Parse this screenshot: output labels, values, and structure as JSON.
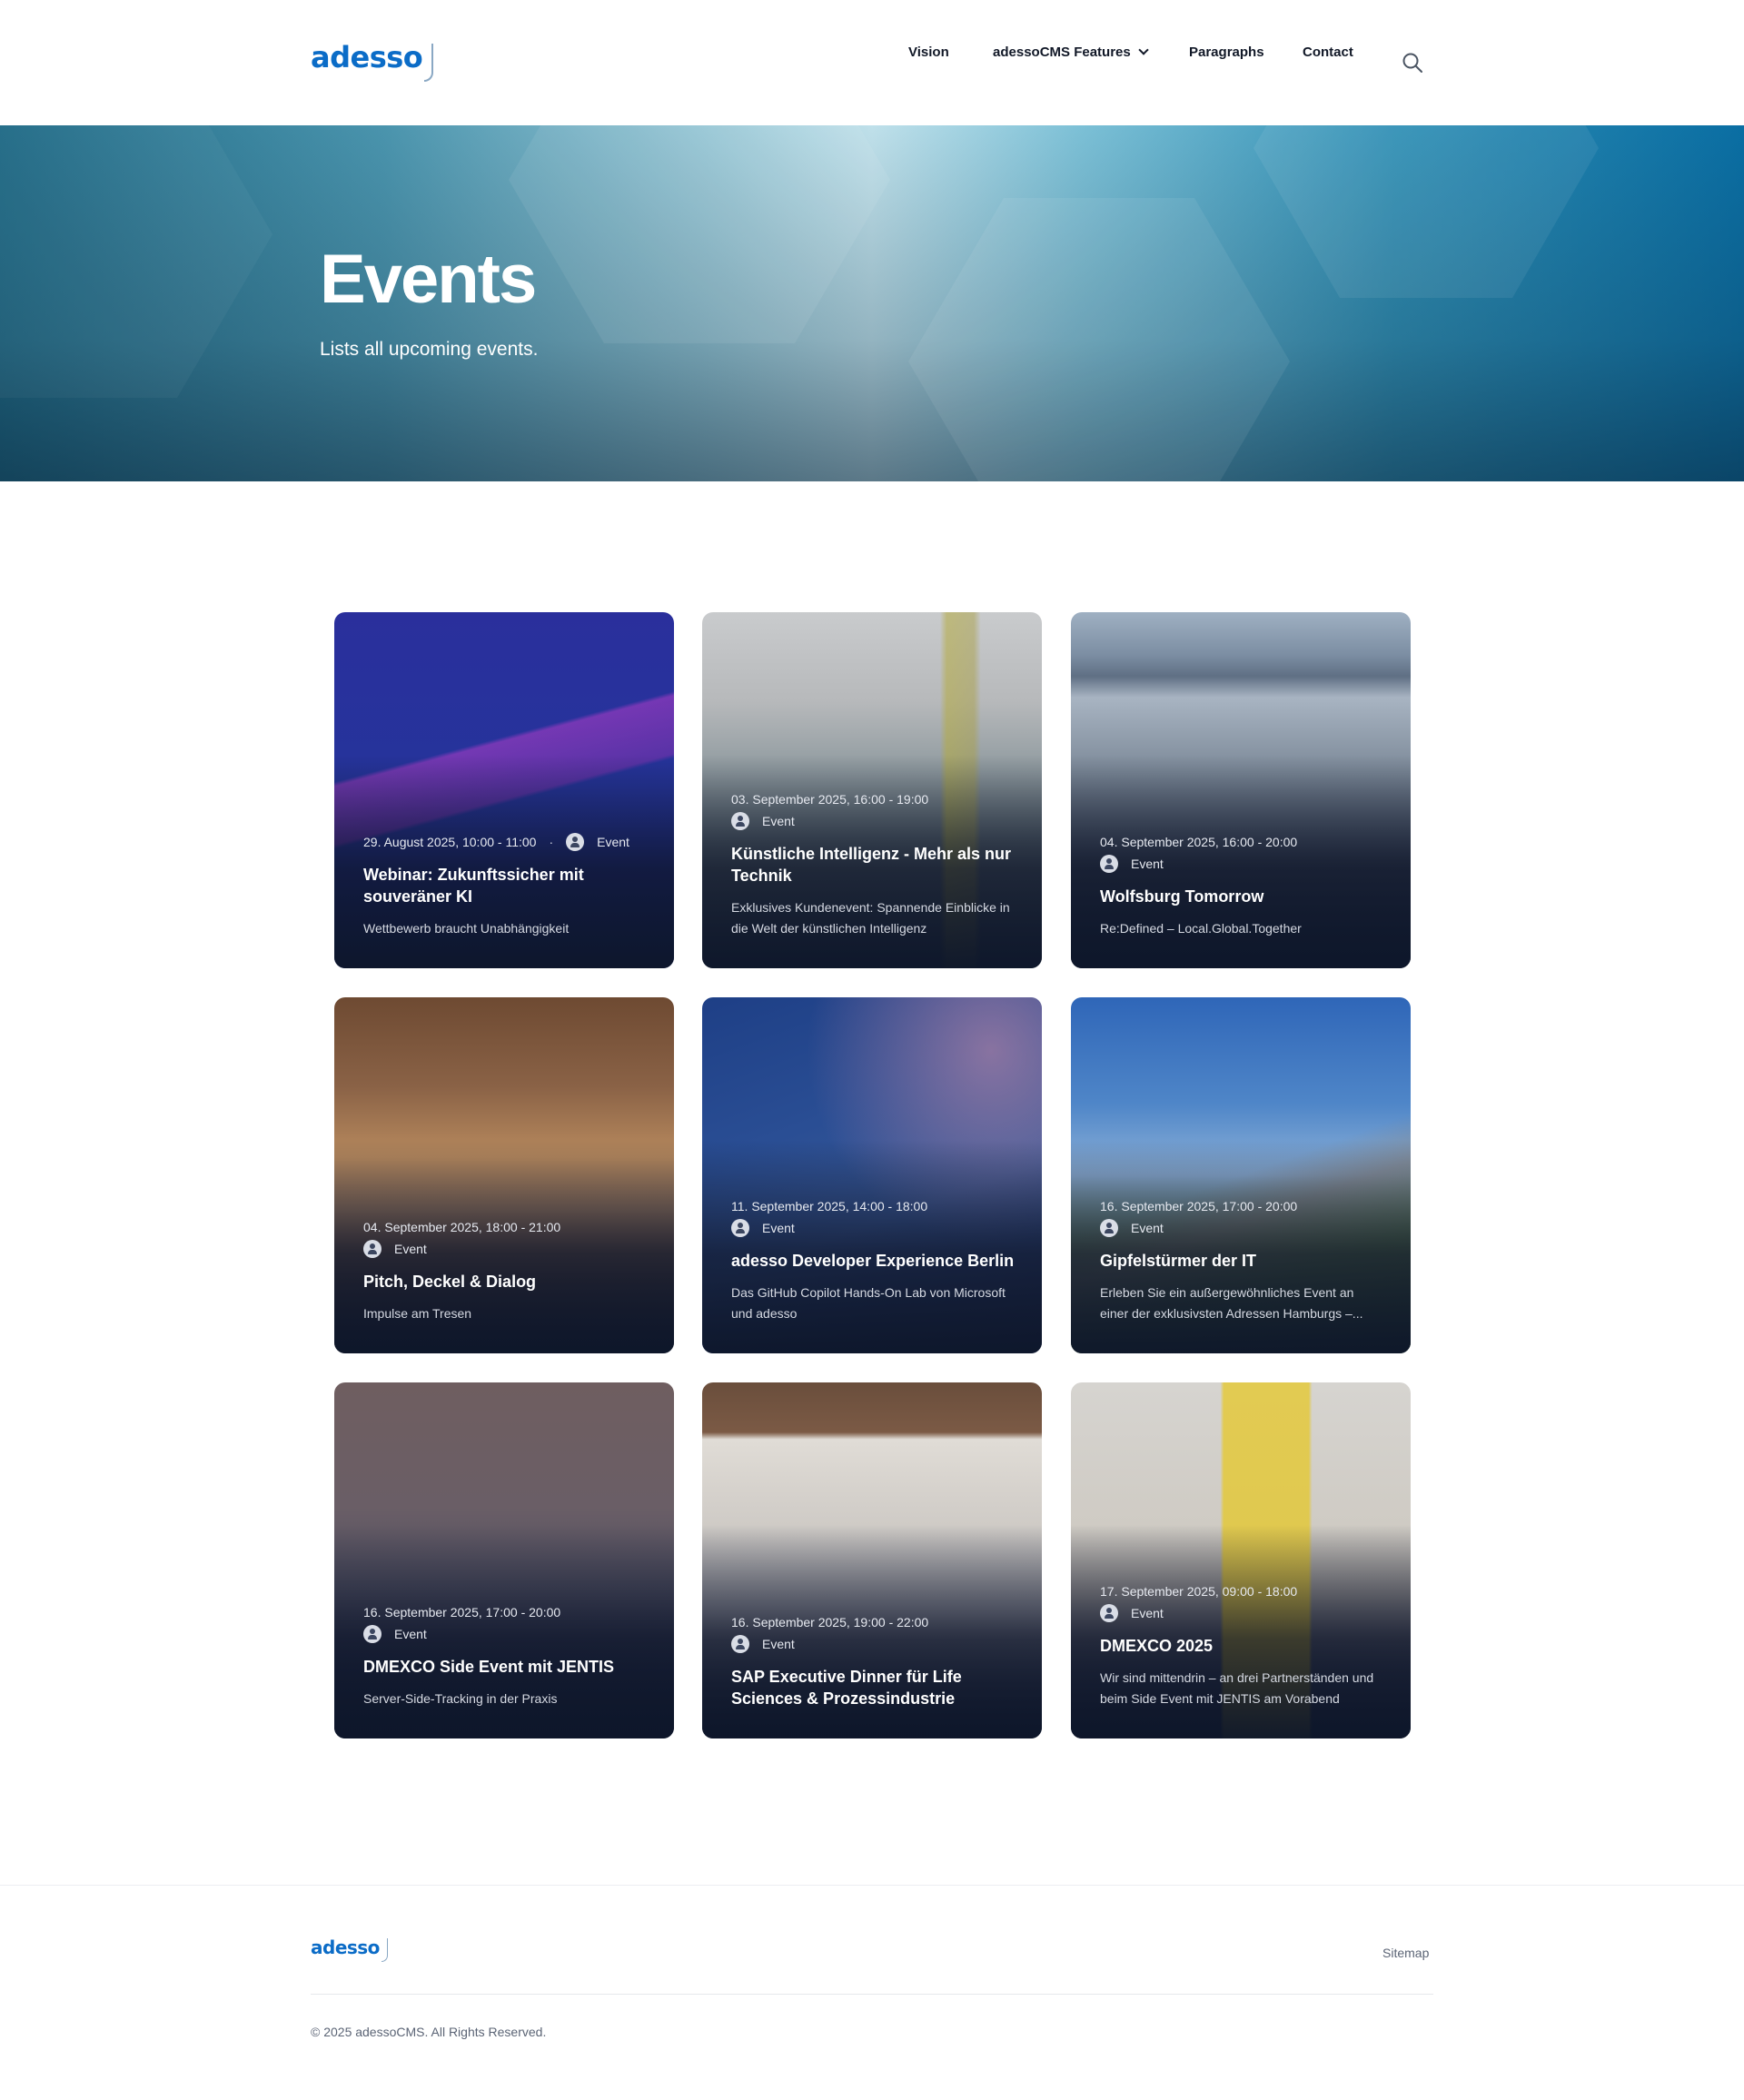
{
  "header": {
    "logo_text": "adesso",
    "nav": [
      {
        "label": "Vision"
      },
      {
        "label": "adessoCMS Features"
      },
      {
        "label": "Paragraphs"
      },
      {
        "label": "Contact"
      }
    ]
  },
  "hero": {
    "title": "Events",
    "subtitle": "Lists all upcoming events."
  },
  "events": [
    {
      "date": "29. August 2025, 10:00 - 11:00",
      "type": "Event",
      "title": "Webinar: Zukunftssicher mit souveräner KI",
      "description": "Wettbewerb braucht Unabhängigkeit"
    },
    {
      "date": "03. September 2025, 16:00 - 19:00",
      "type": "Event",
      "title": "Künstliche Intelligenz - Mehr als nur Technik",
      "description": "Exklusives Kundenevent: Spannende Einblicke in die Welt der künstlichen Intelligenz"
    },
    {
      "date": "04. September 2025, 16:00 - 20:00",
      "type": "Event",
      "title": "Wolfsburg Tomorrow",
      "description": "Re:Defined – Local.Global.Together"
    },
    {
      "date": "04. September 2025, 18:00 - 21:00",
      "type": "Event",
      "title": "Pitch, Deckel & Dialog",
      "description": "Impulse am Tresen"
    },
    {
      "date": "11. September 2025, 14:00 - 18:00",
      "type": "Event",
      "title": "adesso Developer Experience Berlin",
      "description": "Das GitHub Copilot Hands-On Lab von Microsoft und adesso"
    },
    {
      "date": "16. September 2025, 17:00 - 20:00",
      "type": "Event",
      "title": "Gipfelstürmer der IT",
      "description": "Erleben Sie ein außergewöhnliches Event an einer der exklusivsten Adressen Hamburgs –..."
    },
    {
      "date": "16. September 2025, 17:00 - 20:00",
      "type": "Event",
      "title": "DMEXCO Side Event mit JENTIS",
      "description": "Server-Side-Tracking in der Praxis"
    },
    {
      "date": "16. September 2025, 19:00 - 22:00",
      "type": "Event",
      "title": "SAP Executive Dinner für Life Sciences & Prozessindustrie",
      "description": ""
    },
    {
      "date": "17. September 2025, 09:00 - 18:00",
      "type": "Event",
      "title": "DMEXCO 2025",
      "description": "Wir sind mittendrin – an drei Partnerständen und beim Side Event mit JENTIS am Vorabend"
    }
  ],
  "footer": {
    "logo_text": "adesso",
    "sitemap_label": "Sitemap",
    "copyright": "© 2025 adessoCMS. All Rights Reserved."
  }
}
